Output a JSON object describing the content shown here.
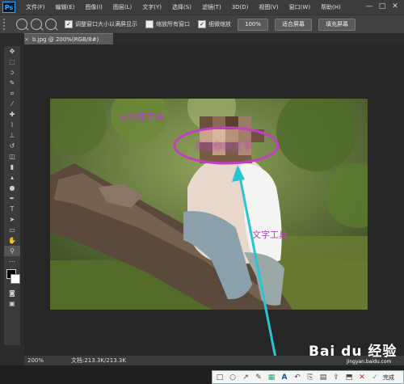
{
  "app": {
    "logo": "Ps"
  },
  "menu": [
    "文件(F)",
    "编辑(E)",
    "图像(I)",
    "图层(L)",
    "文字(Y)",
    "选择(S)",
    "滤镜(T)",
    "3D(D)",
    "视图(V)",
    "窗口(W)",
    "帮助(H)"
  ],
  "window_controls": {
    "minimize": "—",
    "maximize": "□",
    "close": "✕"
  },
  "options_bar": {
    "checkbox_resize": {
      "label": "调整窗口大小以满屏显示",
      "checked": true
    },
    "checkbox_zoom_all": {
      "label": "缩放所有窗口",
      "checked": false
    },
    "checkbox_scrubby": {
      "label": "细微缩放",
      "checked": true
    },
    "btn_100": "100%",
    "btn_fit": "适合屏幕",
    "btn_fill": "填充屏幕"
  },
  "document_tab": {
    "title": "b.jpg @ 200%(RGB/8#)",
    "close": "×"
  },
  "status": {
    "zoom": "200%",
    "doc": "文档:213.3K/213.3K"
  },
  "annotations": {
    "label_1": "马赛克工具",
    "label_2": "文字工具",
    "blurred_text": "添加你的文字"
  },
  "screenshot_toolbar": {
    "icons": [
      "rect-icon",
      "ellipse-icon",
      "arrow-icon",
      "pen-icon",
      "mosaic-icon",
      "text-icon",
      "undo-icon",
      "copy-icon",
      "save-icon",
      "share-icon",
      "pin-icon",
      "cancel-icon",
      "done-icon"
    ],
    "done_label": "完成"
  },
  "watermark": {
    "main": "Bai du 经验",
    "sub": "jingyan.baidu.com"
  },
  "colors": {
    "annotation": "#c13fc4",
    "arrow": "#29c4d4"
  }
}
